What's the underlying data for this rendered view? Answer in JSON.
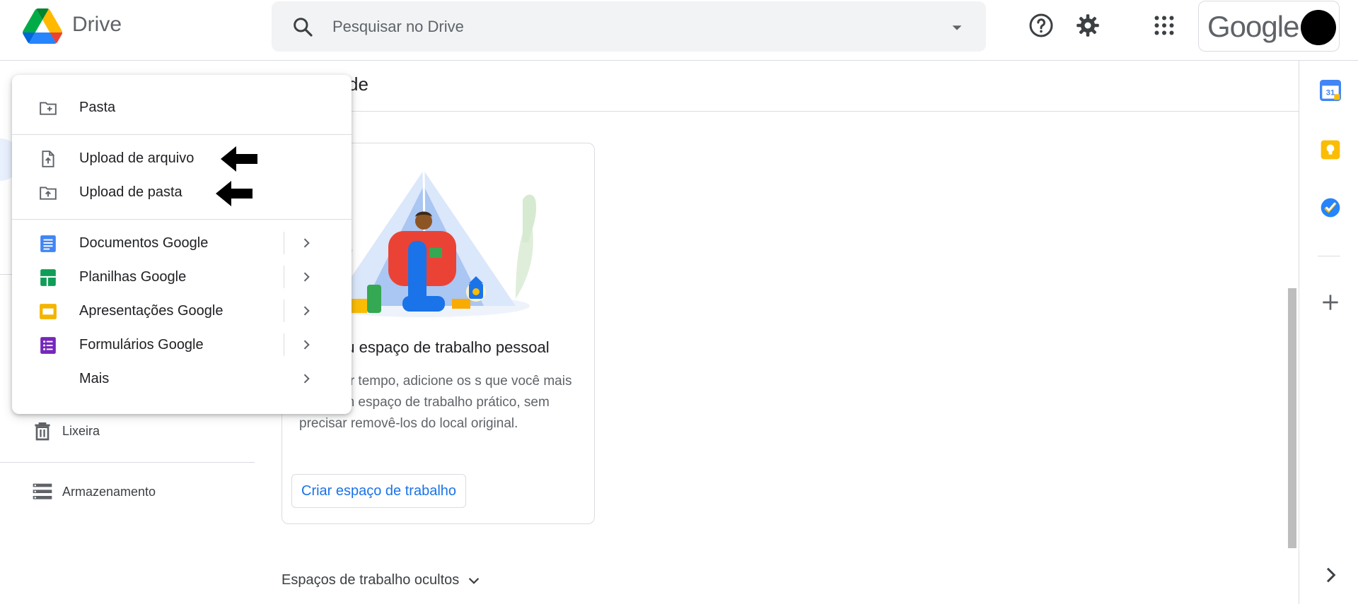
{
  "header": {
    "brand": "Drive",
    "search_placeholder": "Pesquisar no Drive",
    "account_wordmark": "Google"
  },
  "nav": {
    "items": [
      {
        "label": "Lixeira",
        "icon": "trash-icon"
      },
      {
        "label": "Armazenamento",
        "icon": "storage-icon"
      }
    ]
  },
  "main": {
    "heading_fragment": "de",
    "card": {
      "title": "eu espaço de trabalho pessoal",
      "description": "onomizar tempo, adicione os s que você mais usa a um espaço de trabalho prático, sem precisar removê-los do local original.",
      "button_label": "Criar espaço de trabalho"
    },
    "hidden_workspaces_label": "Espaços de trabalho ocultos"
  },
  "new_menu": {
    "items": [
      {
        "label": "Pasta",
        "icon": "new-folder-icon"
      },
      {
        "label": "Upload de arquivo",
        "icon": "file-upload-icon"
      },
      {
        "label": "Upload de pasta",
        "icon": "folder-upload-icon"
      },
      {
        "label": "Documentos Google",
        "icon": "google-docs-icon"
      },
      {
        "label": "Planilhas Google",
        "icon": "google-sheets-icon"
      },
      {
        "label": "Apresentações Google",
        "icon": "google-slides-icon"
      },
      {
        "label": "Formulários Google",
        "icon": "google-forms-icon"
      },
      {
        "label": "Mais",
        "icon": ""
      }
    ]
  },
  "side_panel": {
    "calendar_day": "31",
    "icons": [
      "calendar-icon",
      "keep-icon",
      "tasks-icon",
      "add-icon",
      "expand-icon"
    ]
  },
  "colors": {
    "accent_blue": "#1a73e8",
    "docs_blue": "#4285f4",
    "sheets_green": "#0f9d58",
    "slides_yellow": "#f4b400",
    "forms_purple": "#7627bb"
  }
}
